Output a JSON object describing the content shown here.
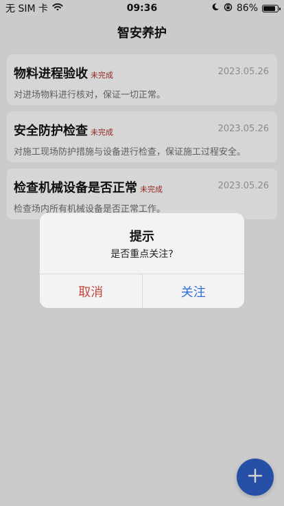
{
  "status_bar": {
    "carrier": "无 SIM 卡",
    "time": "09:36",
    "battery_percent": "86%",
    "battery_level": 0.86,
    "icons": [
      "wifi-icon",
      "moon-icon",
      "rotation-lock-icon",
      "battery-icon"
    ]
  },
  "header": {
    "title": "智安养护"
  },
  "tasks": [
    {
      "title": "物料进程验收",
      "status": "未完成",
      "date": "2023.05.26",
      "description": "对进场物料进行核对，保证一切正常。"
    },
    {
      "title": "安全防护检查",
      "status": "未完成",
      "date": "2023.05.26",
      "description": "对施工现场防护措施与设备进行检查，保证施工过程安全。"
    },
    {
      "title": "检查机械设备是否正常",
      "status": "未完成",
      "date": "2023.05.26",
      "description": "检查场内所有机械设备是否正常工作。"
    }
  ],
  "dialog": {
    "title": "提示",
    "message": "是否重点关注?",
    "cancel_label": "取消",
    "confirm_label": "关注"
  },
  "fab": {
    "icon": "plus-icon"
  },
  "colors": {
    "status_red": "#b0302b",
    "cancel_red": "#c8463c",
    "confirm_blue": "#2f6fd6",
    "fab_blue": "#2e5fc6"
  }
}
